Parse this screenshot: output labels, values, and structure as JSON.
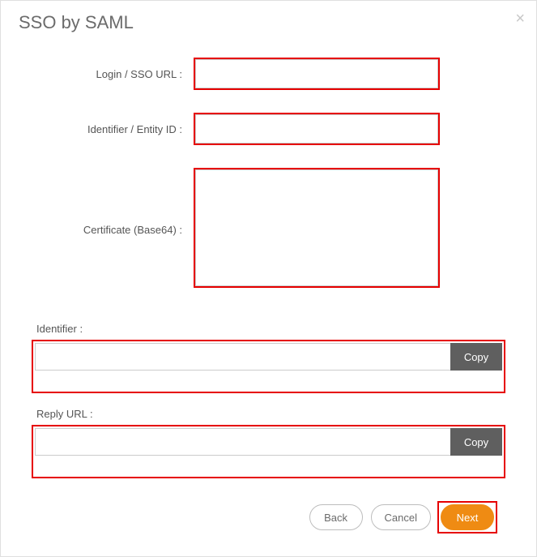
{
  "modal": {
    "title": "SSO by SAML"
  },
  "form": {
    "login_url": {
      "label": "Login / SSO URL :",
      "value": ""
    },
    "entity_id": {
      "label": "Identifier / Entity ID :",
      "value": ""
    },
    "certificate": {
      "label": "Certificate (Base64) :",
      "value": ""
    }
  },
  "readonly": {
    "identifier": {
      "label": "Identifier :",
      "value": "",
      "copy_label": "Copy"
    },
    "reply_url": {
      "label": "Reply URL :",
      "value": "",
      "copy_label": "Copy"
    }
  },
  "buttons": {
    "back": "Back",
    "cancel": "Cancel",
    "next": "Next"
  }
}
